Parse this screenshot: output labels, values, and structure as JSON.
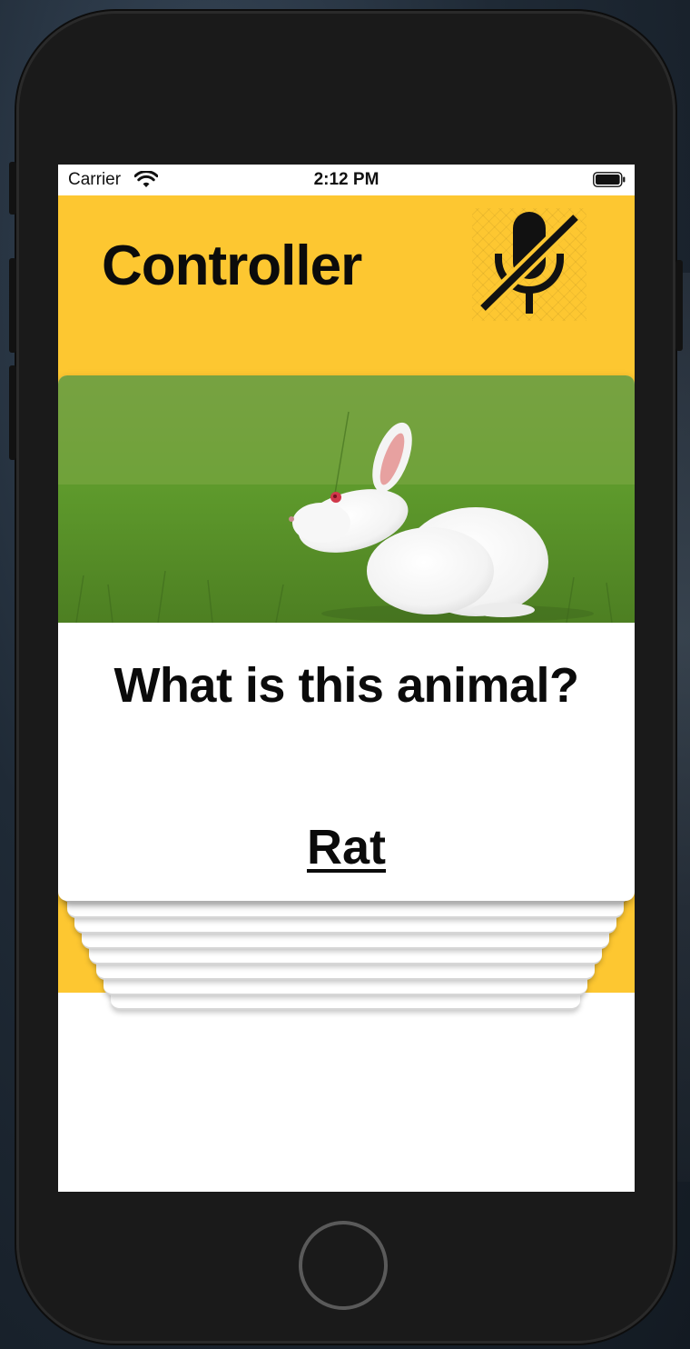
{
  "status_bar": {
    "carrier": "Carrier",
    "time": "2:12 PM",
    "wifi_icon": "wifi-icon",
    "battery_icon": "battery-icon"
  },
  "header": {
    "title": "Controller",
    "mic_icon": "microphone-muted-icon"
  },
  "card": {
    "image": "white-rabbit-on-grass",
    "question": "What is this animal?",
    "answer": "Rat"
  },
  "stacked_cards_count": 8,
  "colors": {
    "accent_yellow": "#fdc731",
    "text": "#0b0b0b",
    "card_background": "#ffffff",
    "device_body": "#1a1a1a"
  }
}
